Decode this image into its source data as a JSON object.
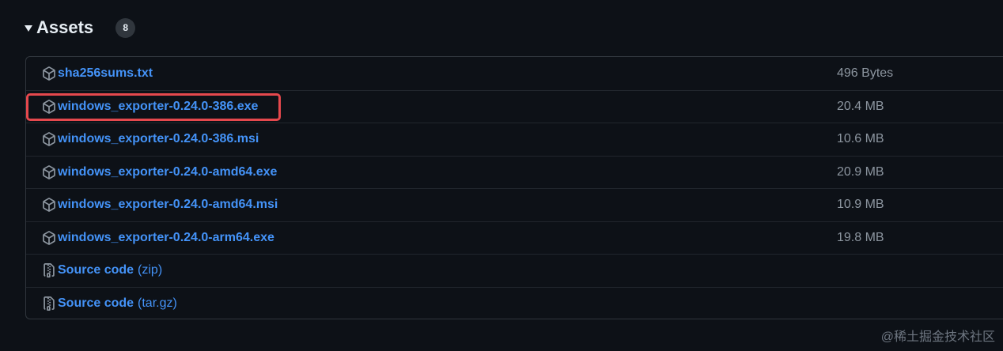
{
  "assets": {
    "title": "Assets",
    "count": "8",
    "items": [
      {
        "name": "sha256sums.txt",
        "size": "496 Bytes",
        "icon": "package-icon"
      },
      {
        "name": "windows_exporter-0.24.0-386.exe",
        "size": "20.4 MB",
        "icon": "package-icon"
      },
      {
        "name": "windows_exporter-0.24.0-386.msi",
        "size": "10.6 MB",
        "icon": "package-icon"
      },
      {
        "name": "windows_exporter-0.24.0-amd64.exe",
        "size": "20.9 MB",
        "icon": "package-icon"
      },
      {
        "name": "windows_exporter-0.24.0-amd64.msi",
        "size": "10.9 MB",
        "icon": "package-icon"
      },
      {
        "name": "windows_exporter-0.24.0-arm64.exe",
        "size": "19.8 MB",
        "icon": "package-icon"
      },
      {
        "name": "Source code",
        "suffix": "(zip)",
        "icon": "file-zip-icon"
      },
      {
        "name": "Source code",
        "suffix": "(tar.gz)",
        "icon": "file-zip-icon"
      }
    ]
  },
  "highlight": {
    "color": "#e5484d",
    "target": "windows_exporter-0.24.0-386.exe"
  },
  "colors": {
    "background": "#0d1117",
    "link": "#4493f8",
    "muted": "#8d96a0",
    "border": "#30363d"
  },
  "watermark": "@稀土掘金技术社区"
}
